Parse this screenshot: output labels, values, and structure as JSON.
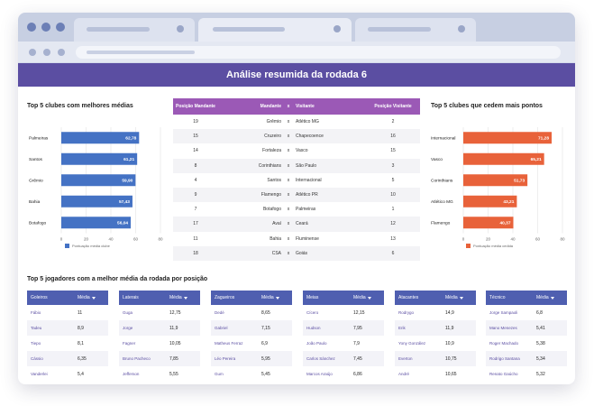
{
  "header": {
    "title": "Análise resumida da rodada 6"
  },
  "left_chart": {
    "title": "Top 5 clubes com melhores médias",
    "legend": "Pontuação média clube",
    "color": "#4472c4"
  },
  "right_chart": {
    "title": "Top 5 clubes que cedem mais pontos",
    "legend": "Pontuação média cedida",
    "color": "#e8623a"
  },
  "chart_data": [
    {
      "type": "bar",
      "orientation": "horizontal",
      "title": "Top 5 clubes com melhores médias",
      "categories": [
        "Palmeiras",
        "Santos",
        "Grêmio",
        "Bahia",
        "Botafogo"
      ],
      "values": [
        62.78,
        61.21,
        59.9,
        57.43,
        56.04
      ],
      "value_labels": [
        "62,78",
        "61,21",
        "59,90",
        "57,43",
        "56,04"
      ],
      "xlim": [
        0,
        80
      ],
      "ticks": [
        "0",
        "20",
        "40",
        "60",
        "80"
      ],
      "legend": "Pontuação média clube"
    },
    {
      "type": "bar",
      "orientation": "horizontal",
      "title": "Top 5 clubes que cedem mais pontos",
      "categories": [
        "Internacional",
        "Vasco",
        "Corinthians",
        "Atlético MG",
        "Flamengo"
      ],
      "values": [
        71.28,
        65.21,
        51.73,
        43.21,
        40.37
      ],
      "value_labels": [
        "71,28",
        "65,21",
        "51,73",
        "43,21",
        "40,37"
      ],
      "xlim": [
        0,
        80
      ],
      "ticks": [
        "0",
        "20",
        "40",
        "60",
        "80"
      ],
      "legend": "Pontuação média cedida"
    }
  ],
  "matches": {
    "headers": [
      "Posição Mandante",
      "Mandante",
      "x",
      "Visitante",
      "Posição Visitante"
    ],
    "rows": [
      [
        "19",
        "Grêmio",
        "x",
        "Atlético MG",
        "2"
      ],
      [
        "15",
        "Cruzeiro",
        "x",
        "Chapecoence",
        "16"
      ],
      [
        "14",
        "Fortaleza",
        "x",
        "Vasco",
        "15"
      ],
      [
        "8",
        "Corinthians",
        "x",
        "São Paulo",
        "3"
      ],
      [
        "4",
        "Santos",
        "x",
        "Internacional",
        "5"
      ],
      [
        "9",
        "Flamengo",
        "x",
        "Atlético PR",
        "10"
      ],
      [
        "7",
        "Botafogo",
        "x",
        "Palmeiras",
        "1"
      ],
      [
        "17",
        "Avaí",
        "x",
        "Ceará",
        "12"
      ],
      [
        "11",
        "Bahia",
        "x",
        "Fluminense",
        "13"
      ],
      [
        "18",
        "CSA",
        "x",
        "Goiás",
        "6"
      ]
    ]
  },
  "positions": {
    "title": "Top 5 jogadores com a melhor média da rodada por posição",
    "tables": [
      {
        "header": "Goleiros",
        "media": "Média",
        "rows": [
          [
            "Fábio",
            "11"
          ],
          [
            "Tadeu",
            "8,9"
          ],
          [
            "Tiepo",
            "8,1"
          ],
          [
            "Cássio",
            "6,35"
          ],
          [
            "Vanderlei",
            "5,4"
          ]
        ]
      },
      {
        "header": "Laterais",
        "media": "Média",
        "rows": [
          [
            "Guga",
            "12,75"
          ],
          [
            "Jorge",
            "11,9"
          ],
          [
            "Fagner",
            "10,05"
          ],
          [
            "Bruno Pacheco",
            "7,85"
          ],
          [
            "Jefferson",
            "5,55"
          ]
        ]
      },
      {
        "header": "Zagueiros",
        "media": "Média",
        "rows": [
          [
            "Dedé",
            "8,65"
          ],
          [
            "Gabriel",
            "7,15"
          ],
          [
            "Matheus Ferraz",
            "6,9"
          ],
          [
            "Léo Pereira",
            "5,95"
          ],
          [
            "Gum",
            "5,45"
          ]
        ]
      },
      {
        "header": "Meias",
        "media": "Média",
        "rows": [
          [
            "Cícero",
            "12,15"
          ],
          [
            "Hudson",
            "7,95"
          ],
          [
            "João Paulo",
            "7,9"
          ],
          [
            "Carlos Sánchez",
            "7,45"
          ],
          [
            "Marcos Araújo",
            "6,86"
          ]
        ]
      },
      {
        "header": "Atacantes",
        "media": "Média",
        "rows": [
          [
            "Rodrygo",
            "14,9"
          ],
          [
            "Erik",
            "11,9"
          ],
          [
            "Yony González",
            "10,9"
          ],
          [
            "Everton",
            "10,75"
          ],
          [
            "André",
            "10,65"
          ]
        ]
      },
      {
        "header": "Técnico",
        "media": "Média",
        "rows": [
          [
            "Jorge Sampaoli",
            "6,8"
          ],
          [
            "Mano Menezes",
            "5,41"
          ],
          [
            "Roger Machado",
            "5,38"
          ],
          [
            "Rodrigo Santana",
            "5,34"
          ],
          [
            "Renato Gaúcho",
            "5,32"
          ]
        ]
      }
    ]
  }
}
